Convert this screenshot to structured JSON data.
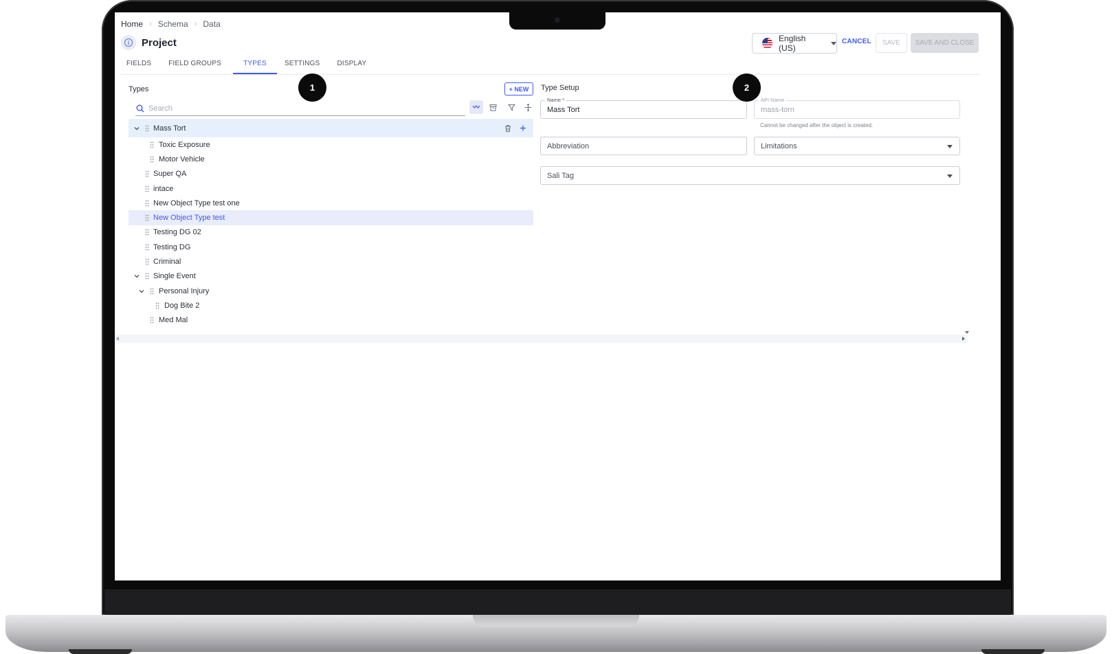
{
  "breadcrumb": [
    "Home",
    "Schema",
    "Data"
  ],
  "page": {
    "title": "Project"
  },
  "header": {
    "language": "English (US)",
    "cancel_label": "CANCEL",
    "save_label": "SAVE",
    "save_close_label": "SAVE AND CLOSE"
  },
  "tabs": [
    {
      "label": "FIELDS",
      "active": false
    },
    {
      "label": "FIELD GROUPS",
      "active": false
    },
    {
      "label": "TYPES",
      "active": true
    },
    {
      "label": "SETTINGS",
      "active": false
    },
    {
      "label": "DISPLAY",
      "active": false
    }
  ],
  "types_panel": {
    "title": "Types",
    "new_label": "+ NEW",
    "search_placeholder": "Search",
    "tree": [
      {
        "label": "Mass Tort",
        "level": 0,
        "expandable": true,
        "state": "selected"
      },
      {
        "label": "Toxic Exposure",
        "level": 1,
        "expandable": false,
        "state": ""
      },
      {
        "label": "Motor Vehicle",
        "level": 1,
        "expandable": false,
        "state": ""
      },
      {
        "label": "Super QA",
        "level": 0,
        "expandable": false,
        "state": ""
      },
      {
        "label": "intace",
        "level": 0,
        "expandable": false,
        "state": ""
      },
      {
        "label": "New Object Type test one",
        "level": 0,
        "expandable": false,
        "state": ""
      },
      {
        "label": "New Object Type test",
        "level": 0,
        "expandable": false,
        "state": "highlight"
      },
      {
        "label": "Testing DG 02",
        "level": 0,
        "expandable": false,
        "state": ""
      },
      {
        "label": "Testing DG",
        "level": 0,
        "expandable": false,
        "state": ""
      },
      {
        "label": "Criminal",
        "level": 0,
        "expandable": false,
        "state": ""
      },
      {
        "label": "Single Event",
        "level": 0,
        "expandable": true,
        "state": ""
      },
      {
        "label": "Personal Injury",
        "level": 1,
        "expandable": true,
        "state": ""
      },
      {
        "label": "Dog Bite 2",
        "level": 2,
        "expandable": false,
        "state": ""
      },
      {
        "label": "Med Mal",
        "level": 1,
        "expandable": false,
        "state": ""
      }
    ]
  },
  "type_setup": {
    "title": "Type Setup",
    "name_label": "Name *",
    "name_value": "Mass Tort",
    "api_label": "API Name",
    "api_value": "mass-torn",
    "api_helper": "Cannot be changed after the object is created.",
    "abbreviation_placeholder": "Abbreviation",
    "limitations_placeholder": "Limitations",
    "sali_placeholder": "Sali Tag"
  },
  "markers": [
    "1",
    "2"
  ],
  "colors": {
    "accent": "#3d5af1",
    "selected_row": "#e6f0fd",
    "highlight_row": "#e9ecfb"
  },
  "icons": [
    "info-icon",
    "us-flag-icon",
    "search-icon",
    "expand-all-icon",
    "archive-icon",
    "filter-icon",
    "move-icon",
    "trash-icon",
    "plus-icon",
    "drag-handle-icon",
    "chevron-down-icon"
  ]
}
